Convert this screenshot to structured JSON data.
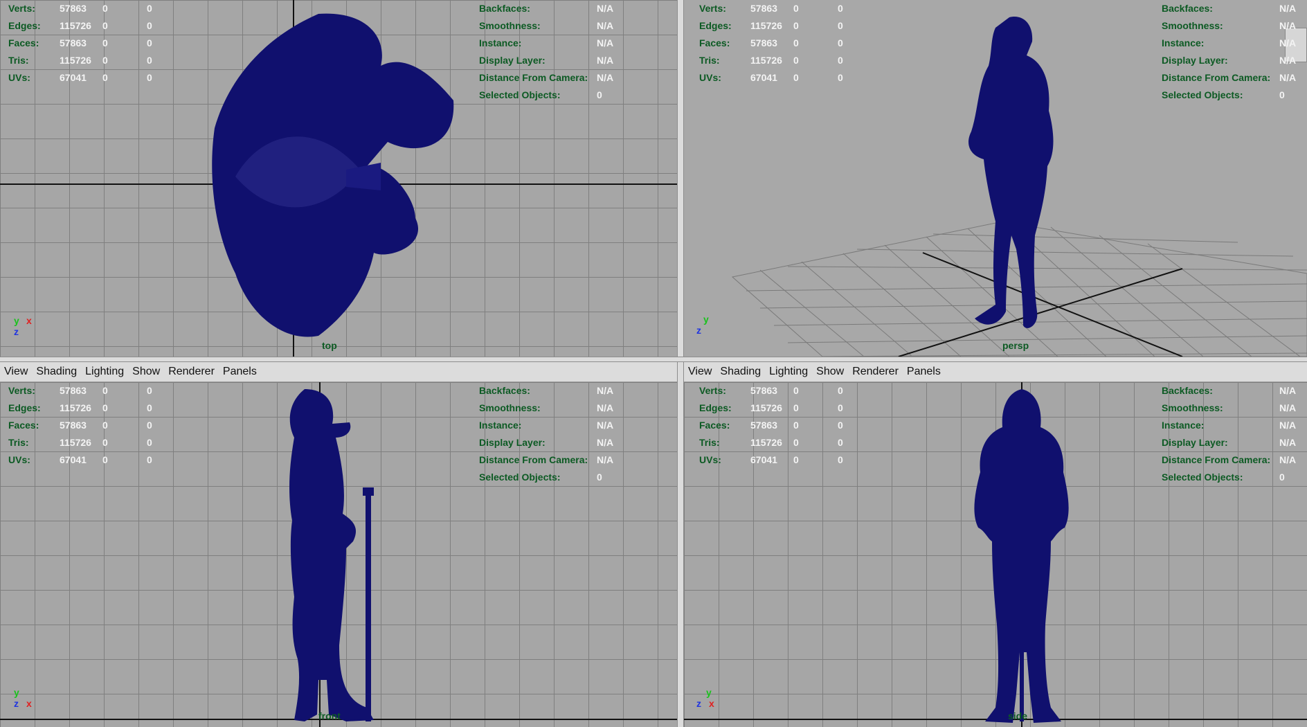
{
  "menu": [
    "View",
    "Shading",
    "Lighting",
    "Show",
    "Renderer",
    "Panels"
  ],
  "hud_left": [
    {
      "label": "Verts:",
      "v1": "57863",
      "v2": "0",
      "v3": "0"
    },
    {
      "label": "Edges:",
      "v1": "115726",
      "v2": "0",
      "v3": "0"
    },
    {
      "label": "Faces:",
      "v1": "57863",
      "v2": "0",
      "v3": "0"
    },
    {
      "label": "Tris:",
      "v1": "115726",
      "v2": "0",
      "v3": "0"
    },
    {
      "label": "UVs:",
      "v1": "67041",
      "v2": "0",
      "v3": "0"
    }
  ],
  "hud_right": [
    {
      "label": "Backfaces:",
      "value": "N/A"
    },
    {
      "label": "Smoothness:",
      "value": "N/A"
    },
    {
      "label": "Instance:",
      "value": "N/A"
    },
    {
      "label": "Display Layer:",
      "value": "N/A"
    },
    {
      "label": "Distance From Camera:",
      "value": "N/A"
    },
    {
      "label": "Selected Objects:",
      "value": "0"
    }
  ],
  "panels": {
    "top": {
      "camera": "top"
    },
    "persp": {
      "camera": "persp"
    },
    "front": {
      "camera": "front"
    },
    "side": {
      "camera": "side"
    }
  },
  "colors": {
    "model": "#10106e",
    "grid": "#7f7f7f",
    "background": "#a6a6a6",
    "hud_label": "#0c5a23"
  },
  "gizmo": {
    "y": "y",
    "x": "x",
    "z": "z"
  }
}
